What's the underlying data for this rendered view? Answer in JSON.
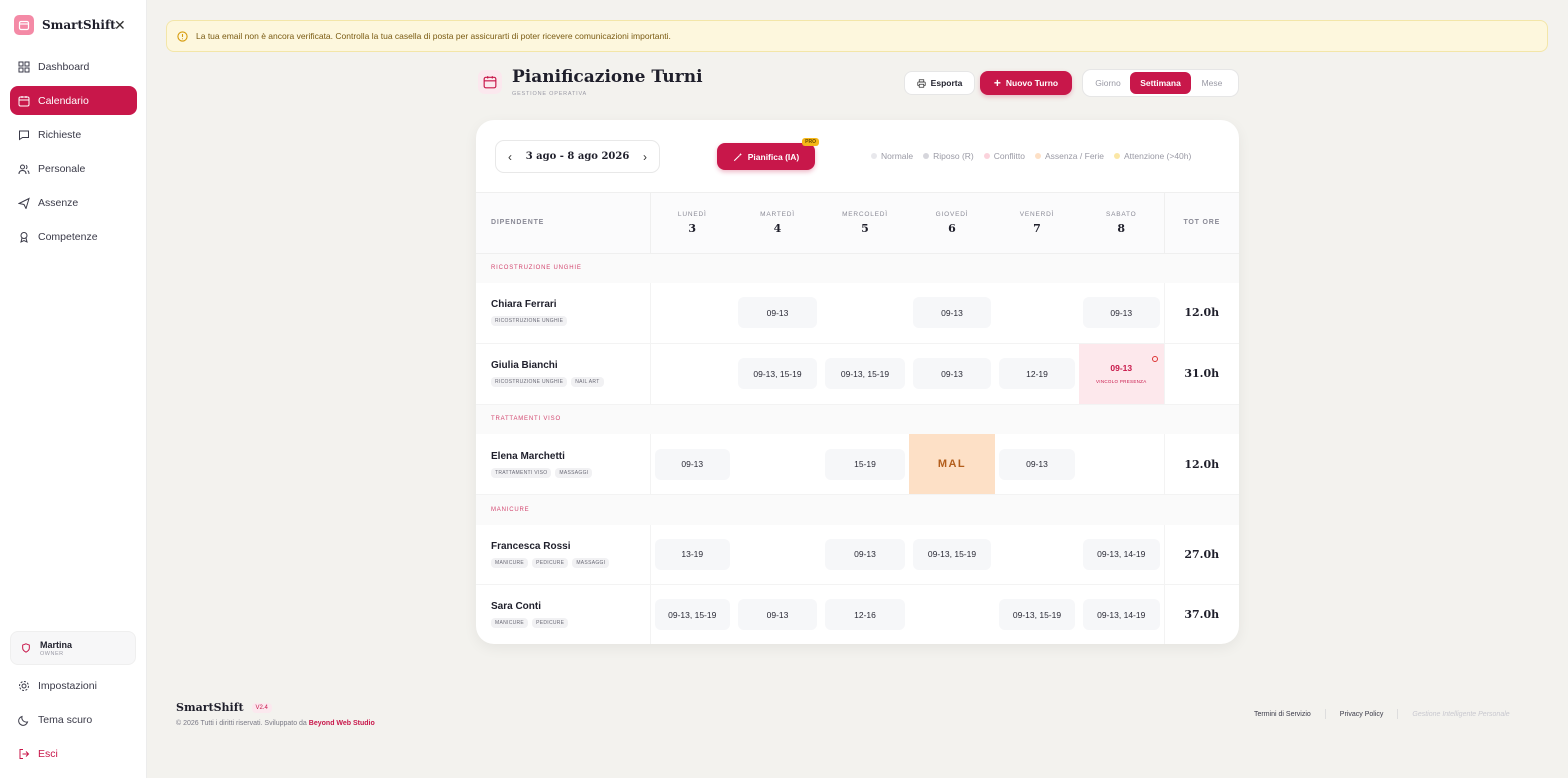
{
  "app": {
    "name": "SmartShift"
  },
  "sidebar": {
    "items": [
      {
        "label": "Dashboard",
        "icon": "grid-icon"
      },
      {
        "label": "Calendario",
        "icon": "calendar-icon",
        "active": true
      },
      {
        "label": "Richieste",
        "icon": "chat-icon"
      },
      {
        "label": "Personale",
        "icon": "users-icon"
      },
      {
        "label": "Assenze",
        "icon": "plane-icon"
      },
      {
        "label": "Competenze",
        "icon": "award-icon"
      }
    ],
    "user": {
      "name": "Martina",
      "role": "OWNER"
    },
    "bottom": {
      "settings": "Impostazioni",
      "theme": "Tema scuro",
      "logout": "Esci"
    }
  },
  "alert": {
    "text": "La tua email non è ancora verificata. Controlla la tua casella di posta per assicurarti di poter ricevere comunicazioni importanti."
  },
  "header": {
    "title": "Pianificazione Turni",
    "subtitle": "GESTIONE OPERATIVA",
    "export_label": "Esporta",
    "new_label": "Nuovo Turno",
    "views": [
      "Giorno",
      "Settimana",
      "Mese"
    ],
    "active_view": "Settimana"
  },
  "toolbar": {
    "date_range": "3 ago - 8 ago 2026",
    "ai_label": "Pianifica (IA)",
    "pro_badge": "PRO",
    "legend": [
      {
        "label": "Normale",
        "color": "#e8e8ec"
      },
      {
        "label": "Riposo (R)",
        "color": "#d6d6dc"
      },
      {
        "label": "Conflitto",
        "color": "#fbd3dc"
      },
      {
        "label": "Assenza / Ferie",
        "color": "#fde0c6"
      },
      {
        "label": "Attenzione (>40h)",
        "color": "#fbe7a6"
      }
    ]
  },
  "schedule": {
    "employee_header": "DIPENDENTE",
    "total_header": "TOT ORE",
    "days": [
      {
        "name": "LUNEDÌ",
        "num": "3"
      },
      {
        "name": "MARTEDÌ",
        "num": "4"
      },
      {
        "name": "MERCOLEDÌ",
        "num": "5"
      },
      {
        "name": "GIOVEDÌ",
        "num": "6"
      },
      {
        "name": "VENERDÌ",
        "num": "7"
      },
      {
        "name": "SABATO",
        "num": "8"
      }
    ],
    "groups": [
      {
        "name": "RICOSTRUZIONE UNGHIE",
        "employees": [
          {
            "name": "Chiara Ferrari",
            "tags": [
              "RICOSTRUZIONE UNGHIE"
            ],
            "shifts": [
              "",
              "09-13",
              "",
              "09-13",
              "",
              "09-13"
            ],
            "total": "12.0h"
          },
          {
            "name": "Giulia Bianchi",
            "tags": [
              "RICOSTRUZIONE UNGHIE",
              "NAIL ART"
            ],
            "shifts": [
              "",
              "09-13, 15-19",
              "09-13, 15-19",
              "09-13",
              "12-19",
              "09-13"
            ],
            "total": "31.0h",
            "conflict": {
              "day": 5,
              "note": "VINCOLO PRESENZA"
            }
          }
        ]
      },
      {
        "name": "TRATTAMENTI VISO",
        "employees": [
          {
            "name": "Elena Marchetti",
            "tags": [
              "TRATTAMENTI VISO",
              "MASSAGGI"
            ],
            "shifts": [
              "09-13",
              "",
              "15-19",
              "MAL",
              "09-13",
              ""
            ],
            "total": "12.0h",
            "absence_day": 3
          }
        ]
      },
      {
        "name": "MANICURE",
        "employees": [
          {
            "name": "Francesca Rossi",
            "tags": [
              "MANICURE",
              "PEDICURE",
              "MASSAGGI"
            ],
            "shifts": [
              "13-19",
              "",
              "09-13",
              "09-13, 15-19",
              "",
              "09-13, 14-19"
            ],
            "total": "27.0h"
          },
          {
            "name": "Sara Conti",
            "tags": [
              "MANICURE",
              "PEDICURE"
            ],
            "shifts": [
              "09-13, 15-19",
              "09-13",
              "12-16",
              "",
              "09-13, 15-19",
              "09-13, 14-19"
            ],
            "total": "37.0h"
          }
        ]
      }
    ]
  },
  "footer": {
    "name": "SmartShift",
    "version": "V2.4",
    "copyright": "© 2026 Tutti i diritti riservati. Sviluppato da",
    "developer": "Beyond Web Studio",
    "links": [
      "Termini di Servizio",
      "Privacy Policy"
    ],
    "tagline": "Gestione Intelligente Personale"
  },
  "colors": {
    "accent": "#c8174a",
    "conflict_bg": "#fde8ec",
    "absence_bg": "#fde0c6"
  }
}
